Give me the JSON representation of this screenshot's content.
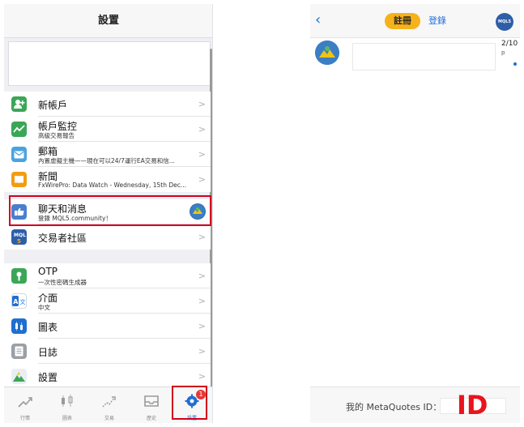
{
  "left": {
    "title": "設置",
    "group1": [
      {
        "title": "新帳戶",
        "sub": "",
        "icon": "add-user-icon",
        "color": "#3aa757"
      },
      {
        "title": "帳戶監控",
        "sub": "高級交易報告",
        "icon": "pulse-chart-icon",
        "color": "#3aa757"
      },
      {
        "title": "郵箱",
        "sub": "內置虛擬主機——現在可以24/7運行EA交易和信...",
        "icon": "mail-icon",
        "color": "#4aa3df"
      },
      {
        "title": "新聞",
        "sub": "FxWirePro: Data Watch - Wednesday, 15th Dec...",
        "icon": "book-icon",
        "color": "#f39c12"
      }
    ],
    "group2": [
      {
        "title": "聊天和消息",
        "sub": "登錄 MQL5.community！",
        "icon": "chat-hand-icon",
        "color": "#4a7fd0"
      },
      {
        "title": "交易者社區",
        "sub": "",
        "icon": "mql5-community-icon",
        "color": "#2f5ea8"
      }
    ],
    "group3": [
      {
        "title": "OTP",
        "sub": "一次性密碼生成器",
        "icon": "otp-key-icon",
        "color": "#3aa757"
      },
      {
        "title": "介面",
        "sub": "中文",
        "icon": "language-icon",
        "color": "#1f6fd1"
      },
      {
        "title": "圖表",
        "sub": "",
        "icon": "candles-icon",
        "color": "#1f6fd1"
      },
      {
        "title": "日誌",
        "sub": "",
        "icon": "journal-icon",
        "color": "#9aa0a6"
      },
      {
        "title": "設置",
        "sub": "",
        "icon": "mt-settings-icon",
        "color": "#2d6fb3"
      }
    ],
    "tabs": [
      {
        "label": "行情",
        "icon": "quotes-icon"
      },
      {
        "label": "圖表",
        "icon": "chart-icon"
      },
      {
        "label": "交易",
        "icon": "trade-icon"
      },
      {
        "label": "歷史",
        "icon": "history-icon"
      },
      {
        "label": "設置",
        "icon": "settings-gear-icon",
        "badge": "1",
        "active": true
      }
    ]
  },
  "right": {
    "back_icon": "back-chevron-icon",
    "segment_active": "註冊",
    "segment_inactive": "登錄",
    "badge_text": "MQL5",
    "chat": {
      "date": "2/10",
      "sub": "p"
    },
    "footer_label": "我的 MetaQuotes ID：",
    "footer_id_annotation": "ID"
  },
  "colors": {
    "accent": "#1f6fd1",
    "highlight": "#d0021b",
    "segment": "#f5b21b"
  }
}
